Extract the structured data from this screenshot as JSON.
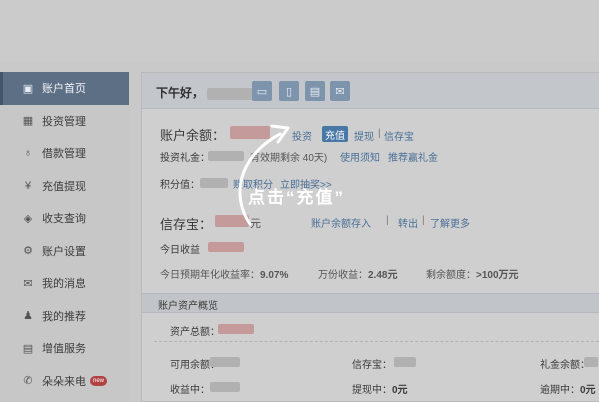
{
  "sidebar": {
    "items": [
      {
        "label": "账户首页",
        "icon": "home-icon",
        "glyph": "▣"
      },
      {
        "label": "投资管理",
        "icon": "chart-icon",
        "glyph": "▦"
      },
      {
        "label": "借款管理",
        "icon": "money-bag-icon",
        "glyph": "♁"
      },
      {
        "label": "充值提现",
        "icon": "yen-icon",
        "glyph": "¥"
      },
      {
        "label": "收支查询",
        "icon": "layers-icon",
        "glyph": "◈"
      },
      {
        "label": "账户设置",
        "icon": "gear-icon",
        "glyph": "⚙"
      },
      {
        "label": "我的消息",
        "icon": "mail-icon",
        "glyph": "✉"
      },
      {
        "label": "我的推荐",
        "icon": "user-add-icon",
        "glyph": "♟"
      },
      {
        "label": "增值服务",
        "icon": "value-service-icon",
        "glyph": "▤"
      },
      {
        "label": "朵朵来电",
        "icon": "phone-icon",
        "glyph": "✆",
        "badge": "new"
      }
    ]
  },
  "header": {
    "greeting": "下午好，"
  },
  "account": {
    "balance_label": "账户余额：",
    "invest": "投资",
    "recharge": "充值",
    "withdraw": "提现",
    "cunbao": "信存宝",
    "gift_label": "投资礼金：",
    "gift_note": "有效期剩余 40天)",
    "usage_note": "使用须知",
    "recommend_gift": "推荐赢礼金",
    "points_label": "积分值：",
    "earn_points": "赚取积分",
    "lottery": "立即抽奖>>"
  },
  "xincunbao": {
    "label": "信存宝：",
    "unit": "元",
    "deposit": "账户余额存入",
    "out": "转出",
    "more": "了解更多",
    "today_label": "今日收益",
    "rate_label": "今日预期年化收益率：",
    "rate_value": "9.07%",
    "per_10k_label": "万份收益：",
    "per_10k_value": "2.48元",
    "remaining_label": "剩余额度：",
    "remaining_value": ">100万元"
  },
  "overview": {
    "title": "账户资产概览",
    "total_label": "资产总额：",
    "available_label": "可用余额：",
    "cunbao_label": "信存宝：",
    "gift_label": "礼金余额：",
    "receiving_label": "收益中：",
    "withdrawing_label": "提现中：",
    "withdrawing_value": "0元",
    "overdue_label": "逾期中：",
    "overdue_value": "0元"
  },
  "annotation": {
    "text": "点击“充值”"
  }
}
